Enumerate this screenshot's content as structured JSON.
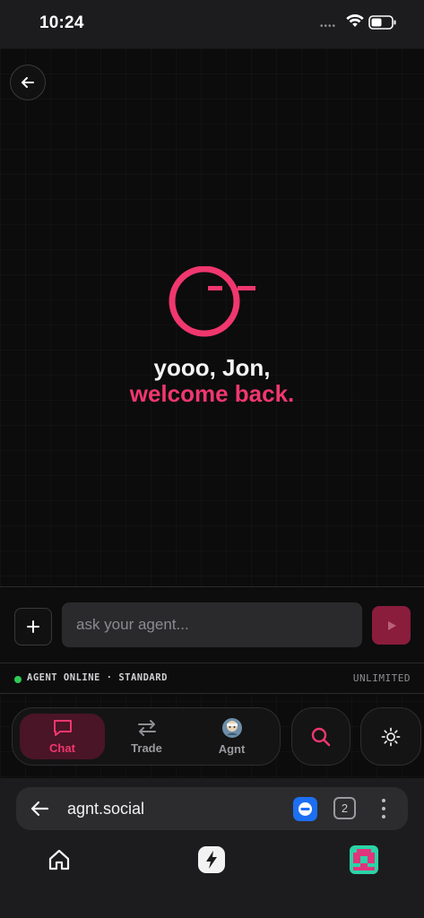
{
  "status_bar": {
    "time": "10:24",
    "signal_dots": "••••"
  },
  "app": {
    "greeting_line1": "yooo, Jon,",
    "greeting_line2": "welcome back.",
    "accent_color": "#f0376e",
    "composer": {
      "placeholder": "ask your agent...",
      "value": ""
    },
    "agent_status": {
      "label": "AGENT ONLINE · STANDARD",
      "limit": "UNLIMITED",
      "status_color": "#2ecc57"
    },
    "nav": {
      "items": [
        {
          "label": "Chat",
          "icon": "chat-bubble-icon",
          "active": true
        },
        {
          "label": "Trade",
          "icon": "swap-arrows-icon",
          "active": false
        },
        {
          "label": "Agnt",
          "icon": "agent-avatar-icon",
          "active": false
        }
      ],
      "search_icon": "search-icon",
      "theme_icon": "sun-icon"
    }
  },
  "browser": {
    "url": "agnt.social",
    "tab_count": "2",
    "extension_icon": "blue-extension-icon",
    "toolbar": [
      "home-icon",
      "bolt-app-icon",
      "profile-avatar-icon"
    ]
  }
}
